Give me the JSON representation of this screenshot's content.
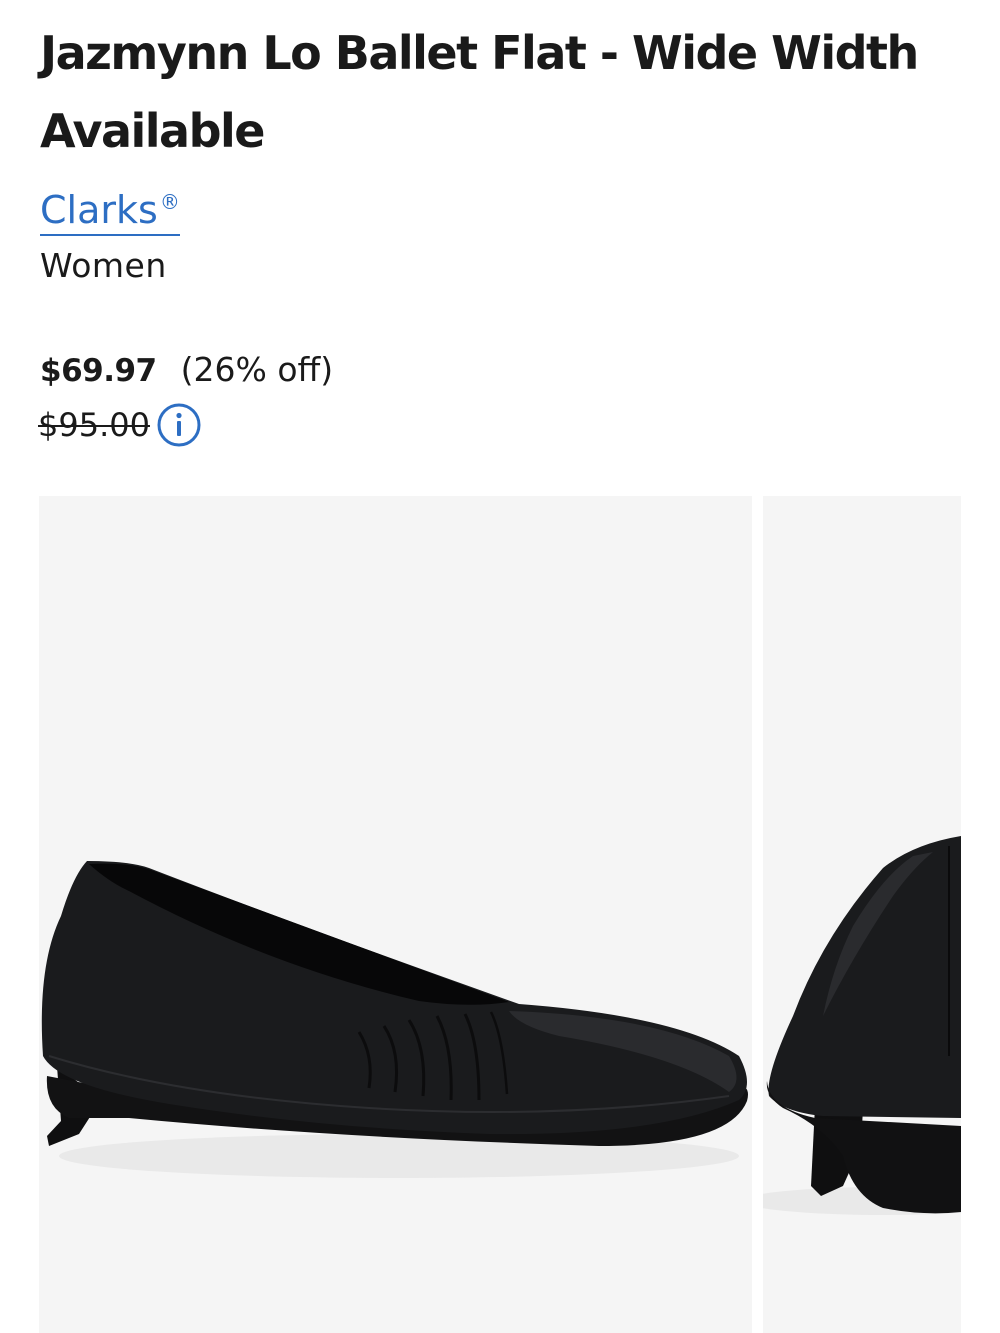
{
  "product": {
    "title": "Jazmynn Lo Ballet Flat - Wide Width Available",
    "brand": "Clarks",
    "brand_mark": "®",
    "gender": "Women"
  },
  "pricing": {
    "current": "$69.97",
    "discount": "(26% off)",
    "original": "$95.00"
  },
  "colors": {
    "brand_link": "#2d6ec3",
    "text": "#1a1a1a",
    "image_bg": "#f5f5f5"
  },
  "icons": {
    "price_info": "info-icon"
  }
}
